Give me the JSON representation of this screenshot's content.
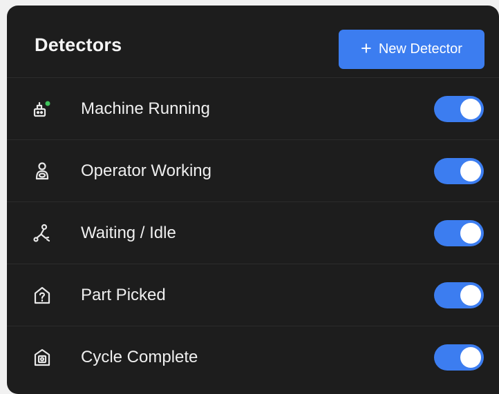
{
  "header": {
    "title": "Detectors",
    "new_button": {
      "plus": "+",
      "label": "New Detector"
    }
  },
  "detectors": [
    {
      "label": "Machine Running",
      "icon": "machine-icon",
      "enabled": true
    },
    {
      "label": "Operator Working",
      "icon": "operator-icon",
      "enabled": true
    },
    {
      "label": "Waiting / Idle",
      "icon": "idle-icon",
      "enabled": true
    },
    {
      "label": "Part Picked",
      "icon": "part-icon",
      "enabled": true
    },
    {
      "label": "Cycle Complete",
      "icon": "cycle-icon",
      "enabled": true
    }
  ],
  "colors": {
    "accent": "#3c7df0",
    "panel": "#1d1d1d",
    "status_dot": "#3fc35c"
  }
}
